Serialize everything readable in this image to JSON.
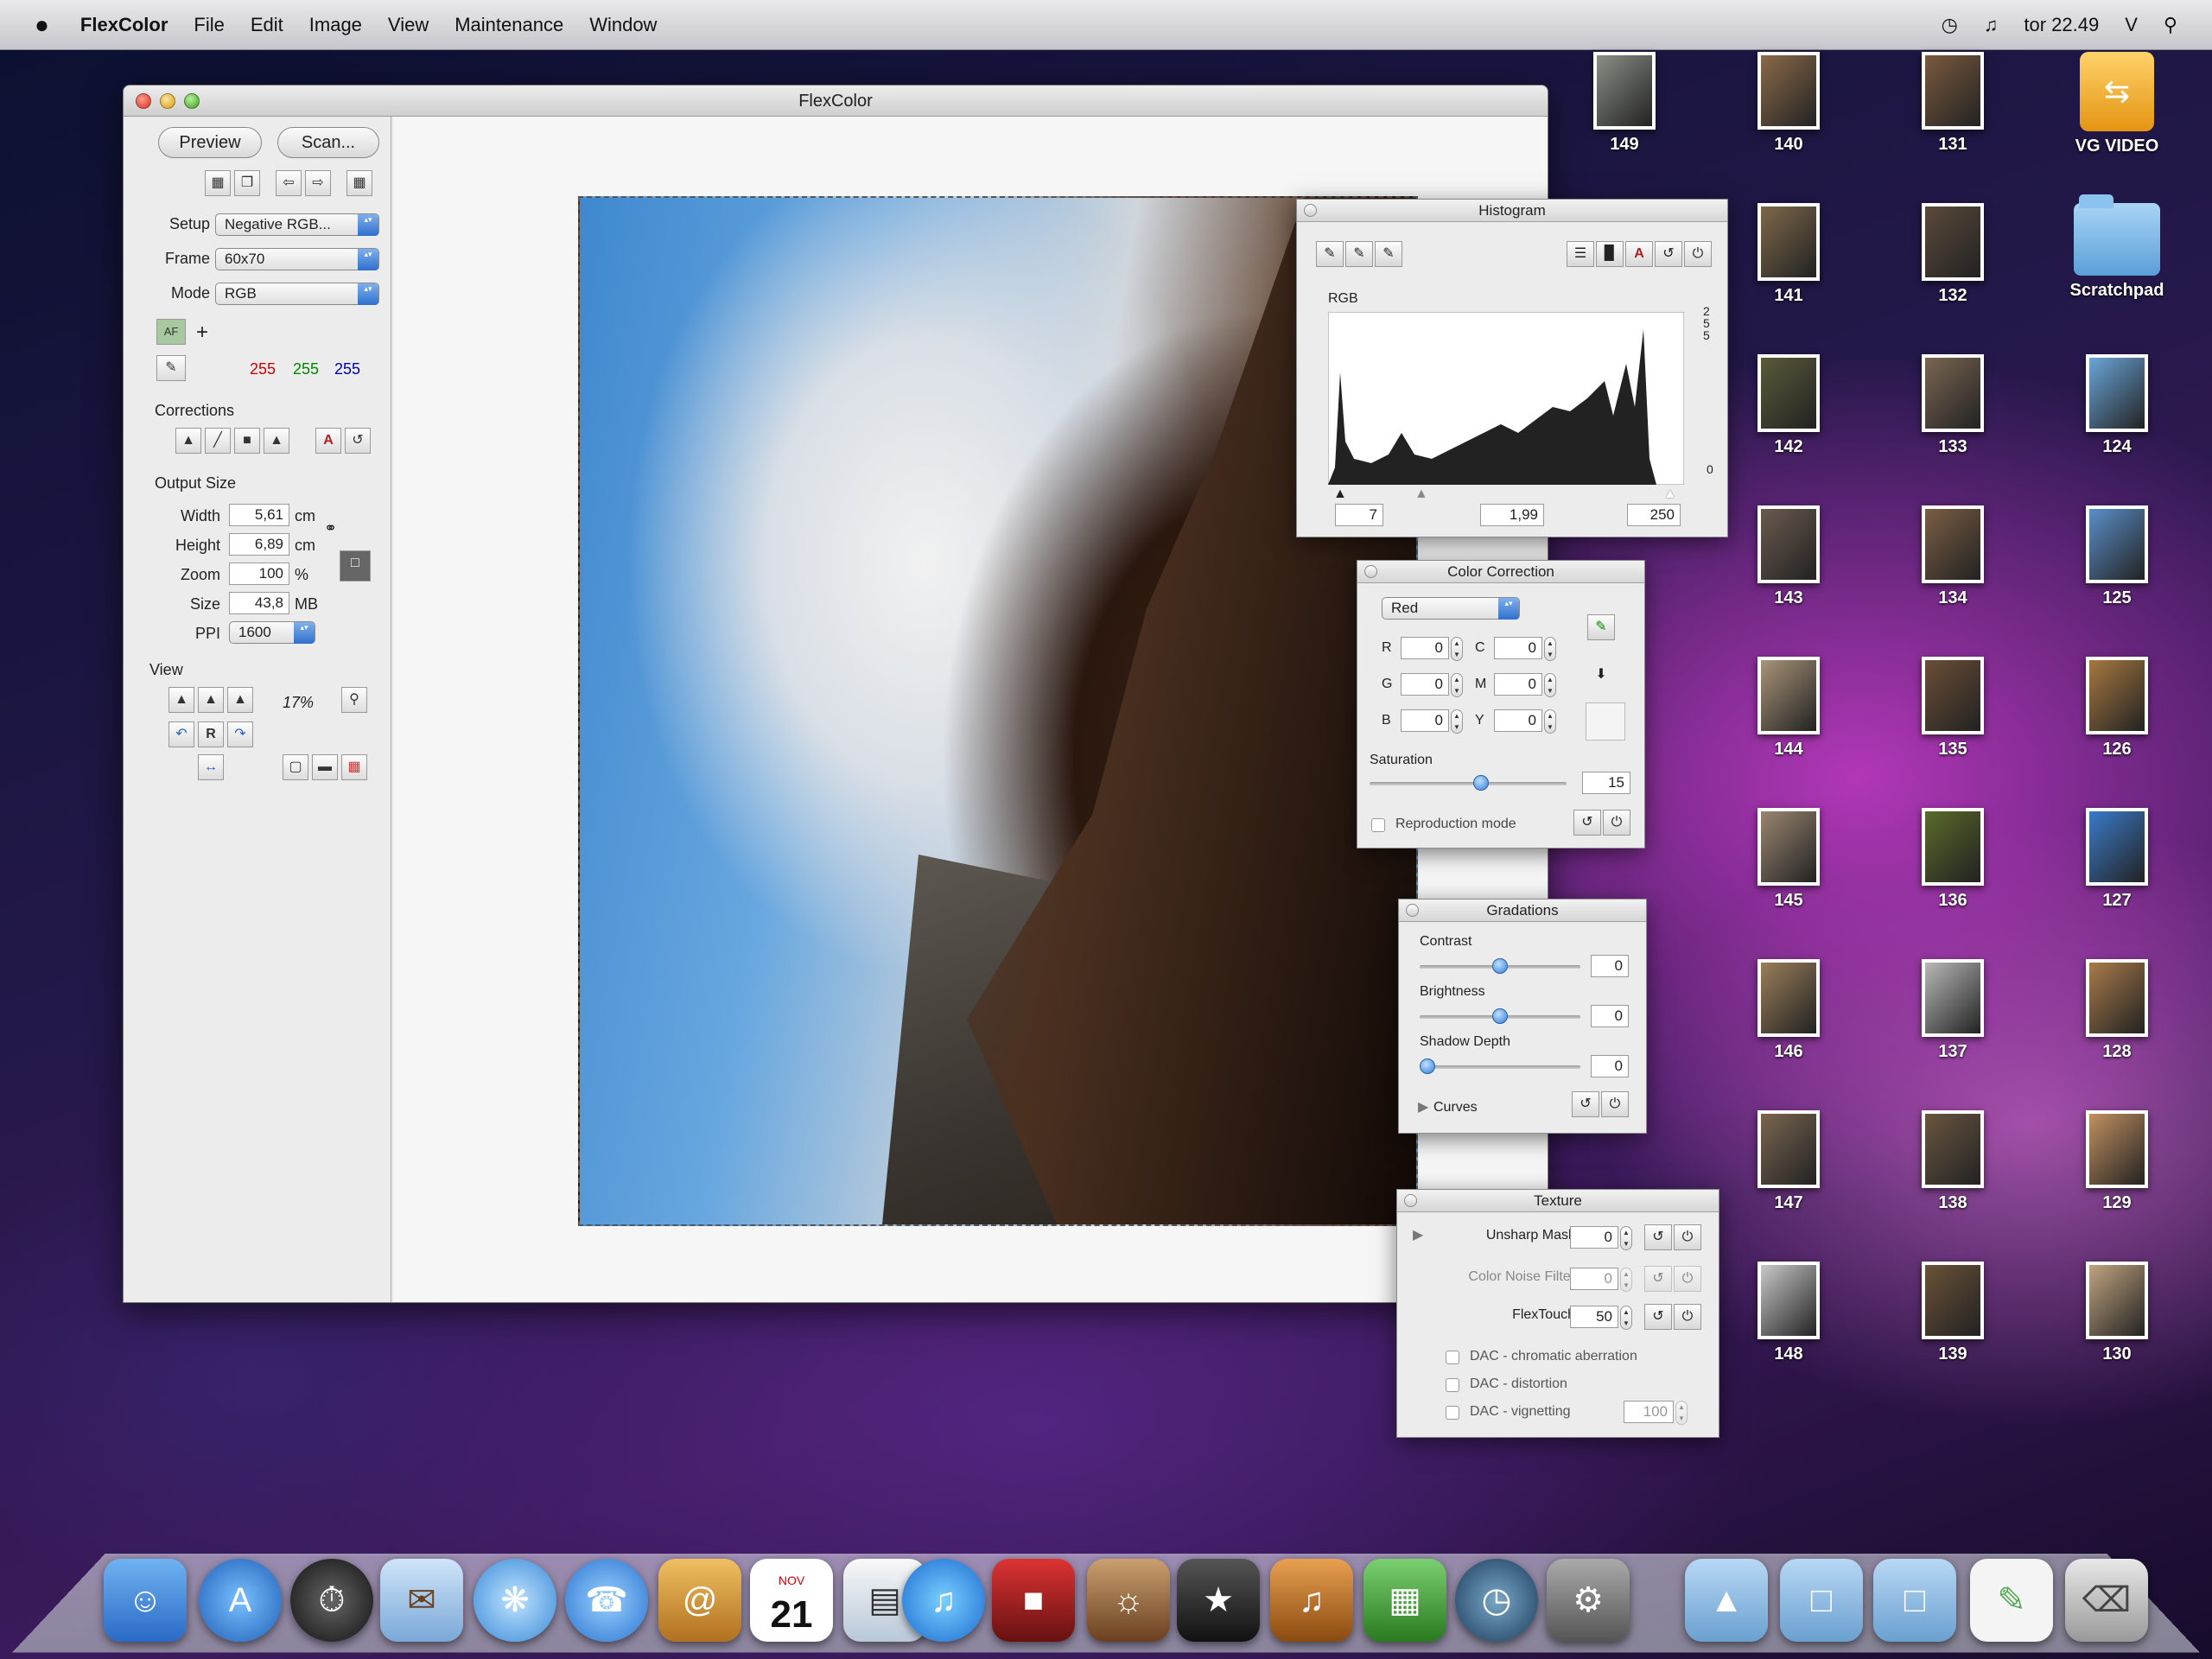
{
  "menubar": {
    "apple": "",
    "app": "FlexColor",
    "menus": [
      "File",
      "Edit",
      "Image",
      "View",
      "Maintenance",
      "Window"
    ],
    "clock": "tor 22.49",
    "user": "V"
  },
  "window": {
    "title": "FlexColor",
    "preview_btn": "Preview",
    "scan_btn": "Scan...",
    "setup_label": "Setup",
    "setup_value": "Negative RGB...",
    "frame_label": "Frame",
    "frame_value": "60x70",
    "mode_label": "Mode",
    "mode_value": "RGB",
    "af_label": "AF",
    "rgb_values": [
      "255",
      "255",
      "255"
    ],
    "corrections_label": "Corrections",
    "output_size_label": "Output Size",
    "width_label": "Width",
    "width_value": "5,61",
    "width_unit": "cm",
    "height_label": "Height",
    "height_value": "6,89",
    "height_unit": "cm",
    "zoom_label": "Zoom",
    "zoom_value": "100",
    "zoom_unit": "%",
    "size_label": "Size",
    "size_value": "43,8",
    "size_unit": "MB",
    "ppi_label": "PPI",
    "ppi_value": "1600",
    "view_label": "View",
    "view_zoom": "17%"
  },
  "histogram": {
    "title": "Histogram",
    "channel": "RGB",
    "top_label": "255",
    "bottom_label": "0",
    "black_point": "7",
    "gamma": "1,99",
    "white_point": "250"
  },
  "color_correction": {
    "title": "Color Correction",
    "color_select": "Red",
    "r_label": "R",
    "r_value": "0",
    "g_label": "G",
    "g_value": "0",
    "b_label": "B",
    "b_value": "0",
    "c_label": "C",
    "c_value": "0",
    "m_label": "M",
    "m_value": "0",
    "y_label": "Y",
    "y_value": "0",
    "saturation_label": "Saturation",
    "saturation_value": "15",
    "reproduction_label": "Reproduction mode"
  },
  "gradations": {
    "title": "Gradations",
    "contrast_label": "Contrast",
    "contrast_value": "0",
    "brightness_label": "Brightness",
    "brightness_value": "0",
    "shadow_label": "Shadow Depth",
    "shadow_value": "0",
    "curves_label": "Curves"
  },
  "texture": {
    "title": "Texture",
    "unsharp_label": "Unsharp Mask",
    "unsharp_value": "0",
    "noise_label": "Color Noise Filter",
    "noise_value": "0",
    "flextouch_label": "FlexTouch",
    "flextouch_value": "50",
    "dac_chromatic": "DAC - chromatic aberration",
    "dac_distortion": "DAC - distortion",
    "dac_vignetting": "DAC - vignetting",
    "vignetting_value": "100"
  },
  "desktop_icons": [
    {
      "label": "149",
      "color": "#8a8f86"
    },
    {
      "label": "140",
      "color": "#8a6a4a"
    },
    {
      "label": "131",
      "color": "#7a5a3e"
    },
    {
      "label": "VG VIDEO",
      "color": "#e49412"
    },
    {
      "label": "141",
      "color": "#7e684a"
    },
    {
      "label": "132",
      "color": "#5a4a3a"
    },
    {
      "label": "Scratchpad",
      "color": "#5a9fd8"
    },
    {
      "label": "142",
      "color": "#5a5a3a"
    },
    {
      "label": "133",
      "color": "#7a6652"
    },
    {
      "label": "124",
      "color": "#6aa5d8"
    },
    {
      "label": "143",
      "color": "#6a5a4e"
    },
    {
      "label": "134",
      "color": "#7a5e44"
    },
    {
      "label": "125",
      "color": "#5a8fc8"
    },
    {
      "label": "144",
      "color": "#a89478"
    },
    {
      "label": "135",
      "color": "#6a4e36"
    },
    {
      "label": "126",
      "color": "#a67840"
    },
    {
      "label": "145",
      "color": "#9a8670"
    },
    {
      "label": "136",
      "color": "#5a6a2a"
    },
    {
      "label": "127",
      "color": "#3a7ac8"
    },
    {
      "label": "146",
      "color": "#9a7e5a"
    },
    {
      "label": "137",
      "color": "#b8b8b8"
    },
    {
      "label": "128",
      "color": "#a87a4a"
    },
    {
      "label": "147",
      "color": "#7a6650"
    },
    {
      "label": "138",
      "color": "#6a5640"
    },
    {
      "label": "129",
      "color": "#c09060"
    },
    {
      "label": "148",
      "color": "#c8c8c8"
    },
    {
      "label": "139",
      "color": "#6a5238"
    },
    {
      "label": "130",
      "color": "#c0a480"
    }
  ],
  "dock": {
    "calendar_month": "NOV",
    "calendar_day": "21"
  }
}
